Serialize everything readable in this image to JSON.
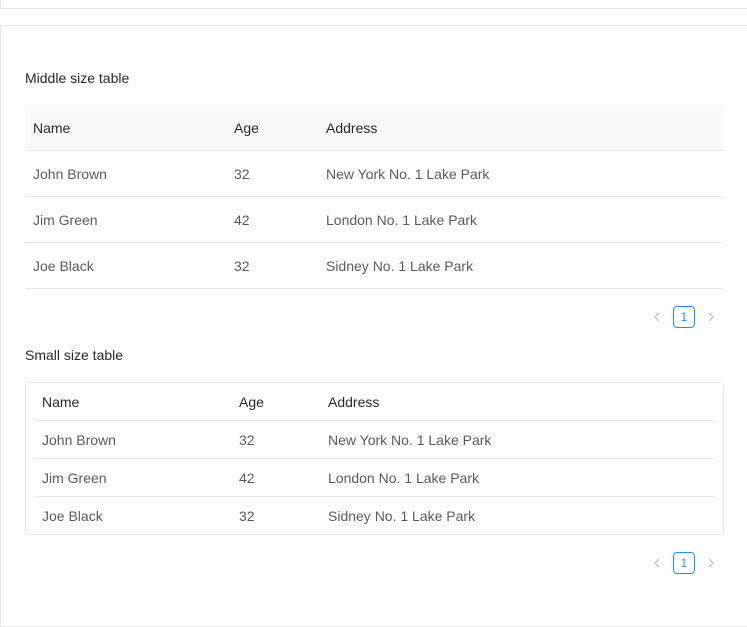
{
  "middle": {
    "title": "Middle size table",
    "columns": [
      "Name",
      "Age",
      "Address"
    ],
    "rows": [
      {
        "name": "John Brown",
        "age": "32",
        "address": "New York No. 1 Lake Park"
      },
      {
        "name": "Jim Green",
        "age": "42",
        "address": "London No. 1 Lake Park"
      },
      {
        "name": "Joe Black",
        "age": "32",
        "address": "Sidney No. 1 Lake Park"
      }
    ],
    "pagination": {
      "current": "1"
    }
  },
  "small": {
    "title": "Small size table",
    "columns": [
      "Name",
      "Age",
      "Address"
    ],
    "rows": [
      {
        "name": "John Brown",
        "age": "32",
        "address": "New York No. 1 Lake Park"
      },
      {
        "name": "Jim Green",
        "age": "42",
        "address": "London No. 1 Lake Park"
      },
      {
        "name": "Joe Black",
        "age": "32",
        "address": "Sidney No. 1 Lake Park"
      }
    ],
    "pagination": {
      "current": "1"
    }
  },
  "icons": {
    "prev": "chevron-left-icon",
    "next": "chevron-right-icon"
  },
  "colors": {
    "accent": "#1890ff",
    "border": "#e8e8e8",
    "header_bg": "#fafafa"
  }
}
